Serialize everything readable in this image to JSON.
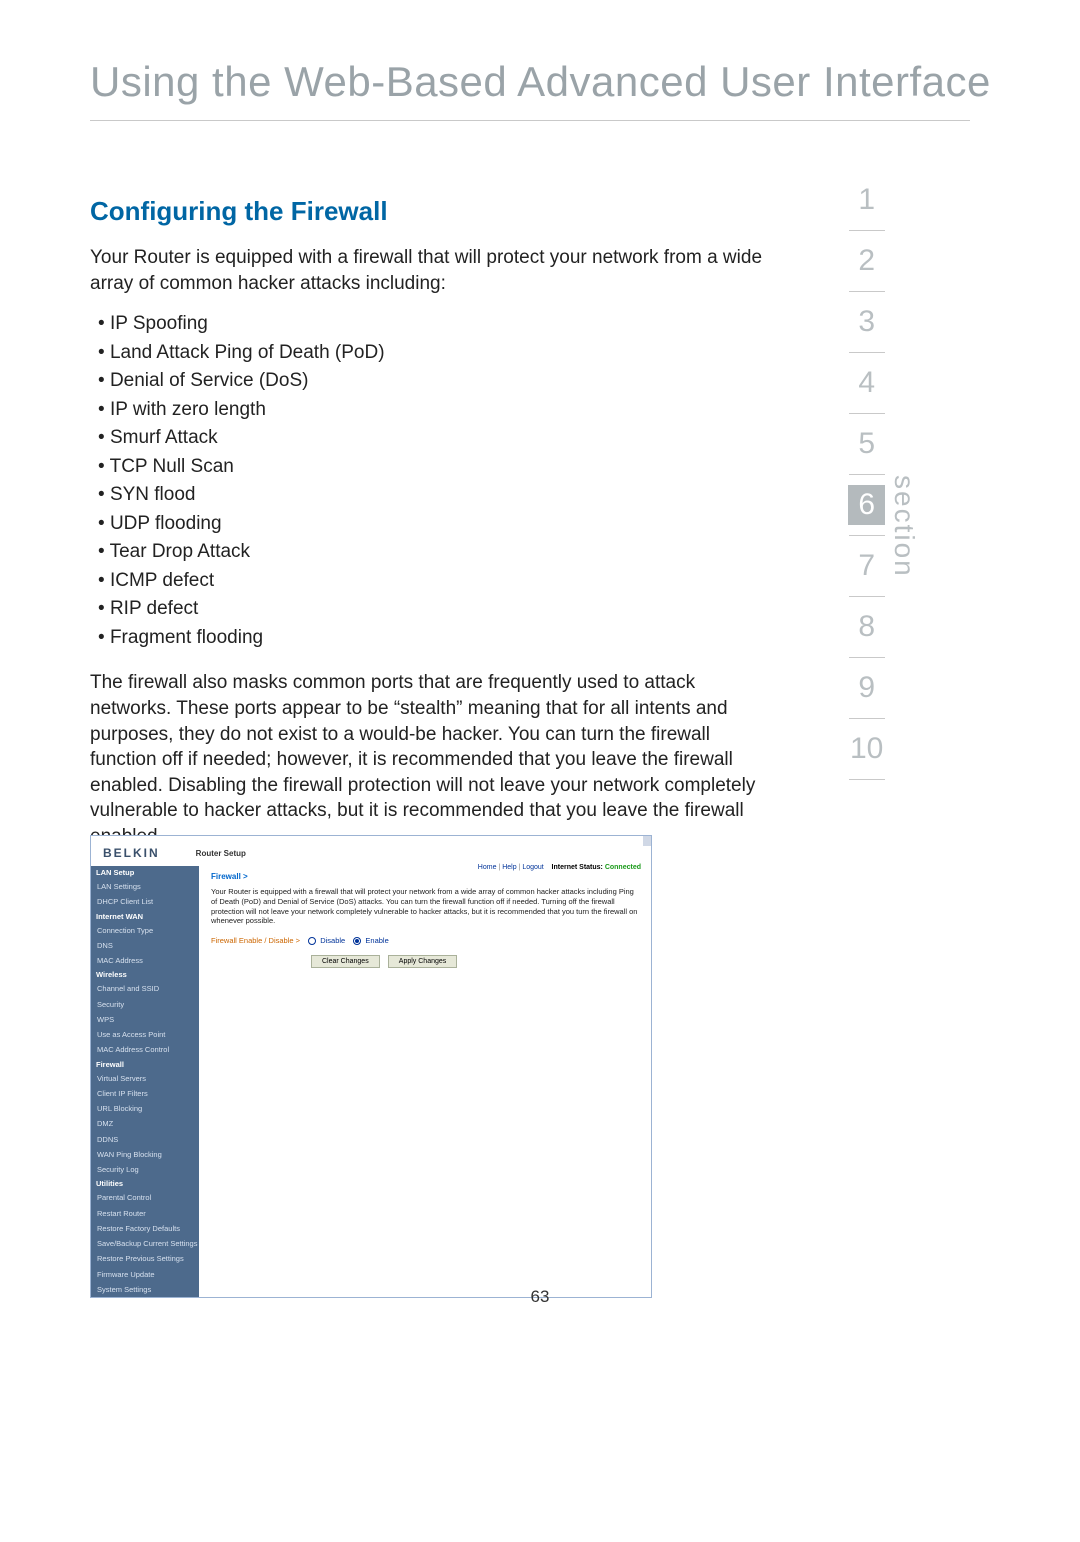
{
  "page": {
    "title": "Using the Web-Based Advanced User Interface",
    "number": "63",
    "section_word": "section"
  },
  "sections": {
    "items": [
      "1",
      "2",
      "3",
      "4",
      "5",
      "6",
      "7",
      "8",
      "9",
      "10"
    ],
    "active_index": 5
  },
  "content": {
    "subtitle": "Configuring the Firewall",
    "intro": "Your Router is equipped with a firewall that will protect your network from a wide array of common hacker attacks including:",
    "attacks": [
      "IP Spoofing",
      "Land Attack Ping of Death (PoD)",
      "Denial of Service (DoS)",
      "IP with zero length",
      "Smurf Attack",
      "TCP Null Scan",
      "SYN flood",
      "UDP flooding",
      "Tear Drop Attack",
      "ICMP defect",
      "RIP defect",
      "Fragment flooding"
    ],
    "paragraph2": "The firewall also masks common ports that are frequently used to attack networks. These ports appear to be “stealth” meaning that for all intents and purposes, they do not exist to a would-be hacker. You can turn the firewall function off if needed; however, it is recommended that you leave the firewall enabled. Disabling the firewall protection will not leave your network completely vulnerable to hacker attacks, but it is recommended that you leave the firewall enabled."
  },
  "screenshot": {
    "logo": "BELKIN",
    "router_setup": "Router Setup",
    "top_links": {
      "home": "Home",
      "help": "Help",
      "logout": "Logout",
      "status_label": "Internet Status:",
      "status_value": "Connected"
    },
    "sidebar": [
      {
        "label": "LAN Setup",
        "type": "head"
      },
      {
        "label": "LAN Settings",
        "type": "item"
      },
      {
        "label": "DHCP Client List",
        "type": "item"
      },
      {
        "label": "Internet WAN",
        "type": "head"
      },
      {
        "label": "Connection Type",
        "type": "item"
      },
      {
        "label": "DNS",
        "type": "item"
      },
      {
        "label": "MAC Address",
        "type": "item"
      },
      {
        "label": "Wireless",
        "type": "head"
      },
      {
        "label": "Channel and SSID",
        "type": "item"
      },
      {
        "label": "Security",
        "type": "item"
      },
      {
        "label": "WPS",
        "type": "item"
      },
      {
        "label": "Use as Access Point",
        "type": "item"
      },
      {
        "label": "MAC Address Control",
        "type": "item"
      },
      {
        "label": "Firewall",
        "type": "head active"
      },
      {
        "label": "Virtual Servers",
        "type": "item"
      },
      {
        "label": "Client IP Filters",
        "type": "item"
      },
      {
        "label": "URL Blocking",
        "type": "item"
      },
      {
        "label": "DMZ",
        "type": "item"
      },
      {
        "label": "DDNS",
        "type": "item"
      },
      {
        "label": "WAN Ping Blocking",
        "type": "item"
      },
      {
        "label": "Security Log",
        "type": "item"
      },
      {
        "label": "Utilities",
        "type": "head"
      },
      {
        "label": "Parental Control",
        "type": "item"
      },
      {
        "label": "Restart Router",
        "type": "item"
      },
      {
        "label": "Restore Factory Defaults",
        "type": "item"
      },
      {
        "label": "Save/Backup Current Settings",
        "type": "item"
      },
      {
        "label": "Restore Previous Settings",
        "type": "item"
      },
      {
        "label": "Firmware Update",
        "type": "item"
      },
      {
        "label": "System Settings",
        "type": "item"
      }
    ],
    "main": {
      "title": "Firewall >",
      "desc": "Your Router is equipped with a firewall that will protect your network from a wide array of common hacker attacks including Ping of Death (PoD) and Denial of Service (DoS) attacks. You can turn the firewall function off if needed. Turning off the firewall protection will not leave your network completely vulnerable to hacker attacks, but it is recommended that you turn the firewall on whenever possible.",
      "last_phrase": "whenever possible.",
      "radio_label": "Firewall Enable / Disable >",
      "disable": "Disable",
      "enable": "Enable",
      "clear": "Clear Changes",
      "apply": "Apply Changes"
    }
  }
}
